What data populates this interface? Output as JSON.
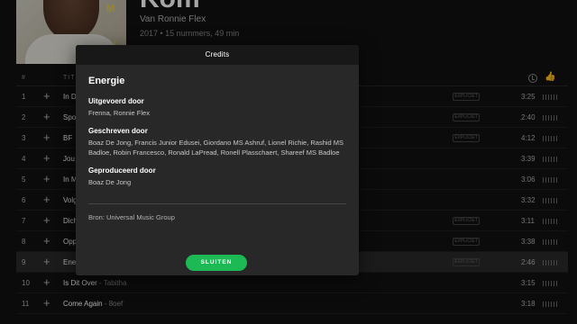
{
  "album": {
    "title": "Kom",
    "artist_prefix": "Van",
    "artist": "Ronnie Flex",
    "meta": "2017 • 15 nummers, 49 min",
    "cover_marks": [
      "M",
      "I"
    ]
  },
  "track_header": {
    "num": "#",
    "title": "TITEL"
  },
  "tracks": [
    {
      "num": "1",
      "name": "In D",
      "feat": "",
      "duration": "3:25",
      "badge": "EXPLICIET"
    },
    {
      "num": "2",
      "name": "Spo",
      "feat": "",
      "duration": "2:40",
      "badge": "EXPLICIET"
    },
    {
      "num": "3",
      "name": "BF",
      "feat": "",
      "duration": "4:12",
      "badge": "EXPLICIET"
    },
    {
      "num": "4",
      "name": "Jou",
      "feat": "",
      "duration": "3:39",
      "badge": ""
    },
    {
      "num": "5",
      "name": "In M",
      "feat": "",
      "duration": "3:06",
      "badge": ""
    },
    {
      "num": "6",
      "name": "Volg",
      "feat": "",
      "duration": "3:32",
      "badge": ""
    },
    {
      "num": "7",
      "name": "Dich",
      "feat": "",
      "duration": "3:11",
      "badge": "EXPLICIET"
    },
    {
      "num": "8",
      "name": "Opp",
      "feat": "",
      "duration": "3:38",
      "badge": "EXPLICIET"
    },
    {
      "num": "9",
      "name": "Ene",
      "feat": "",
      "duration": "2:46",
      "badge": "EXPLICIET"
    },
    {
      "num": "10",
      "name": "Is Dit Over",
      "feat": " - Tabitha",
      "duration": "3:15",
      "badge": ""
    },
    {
      "num": "11",
      "name": "Come Again",
      "feat": " - 8oef",
      "duration": "3:18",
      "badge": ""
    }
  ],
  "modal": {
    "header": "Credits",
    "song_title": "Energie",
    "groups": [
      {
        "role": "Uitgevoerd door",
        "names": "Frenna, Ronnie Flex"
      },
      {
        "role": "Geschreven door",
        "names": "Boaz De Jong, Francis Junior Edusei, Giordano MS Ashruf, Lionel Richie, Rashid MS Badloe, Robin Francesco, Ronald LaPread, Ronell Plasschaert, Shareef MS Badloe"
      },
      {
        "role": "Geproduceerd door",
        "names": "Boaz De Jong"
      }
    ],
    "source": "Bron: Universal Music Group",
    "close_label": "SLUITEN"
  },
  "colors": {
    "accent": "#1db954",
    "background": "#121212",
    "modal": "#282828",
    "modal_header": "#181818"
  }
}
